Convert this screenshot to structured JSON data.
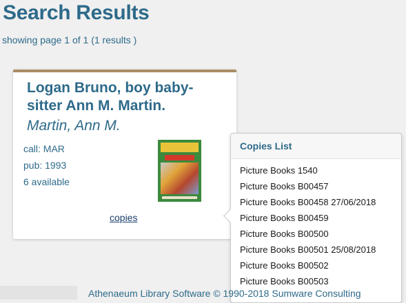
{
  "page": {
    "title": "Search Results",
    "subtitle": "showing page 1 of 1 (1 results )"
  },
  "result": {
    "title": "Logan Bruno, boy baby-sitter Ann M. Martin.",
    "author": "Martin, Ann M.",
    "call": "call: MAR",
    "pub": "pub: 1993",
    "available": "6 available",
    "copies_link": "copies"
  },
  "copies_popover": {
    "header": "Copies List",
    "items": [
      "Picture Books 1540",
      "Picture Books B00457",
      "Picture Books B00458 27/06/2018",
      "Picture Books B00459",
      "Picture Books B00500",
      "Picture Books B00501 25/08/2018",
      "Picture Books B00502",
      "Picture Books B00503"
    ]
  },
  "footer": {
    "text": "Athenaeum Library Software © 1990-2018 Sumware Consulting"
  },
  "colors": {
    "accent": "#2e6a8a",
    "card_top_border": "#a88c63",
    "link": "#1a3e6e"
  }
}
